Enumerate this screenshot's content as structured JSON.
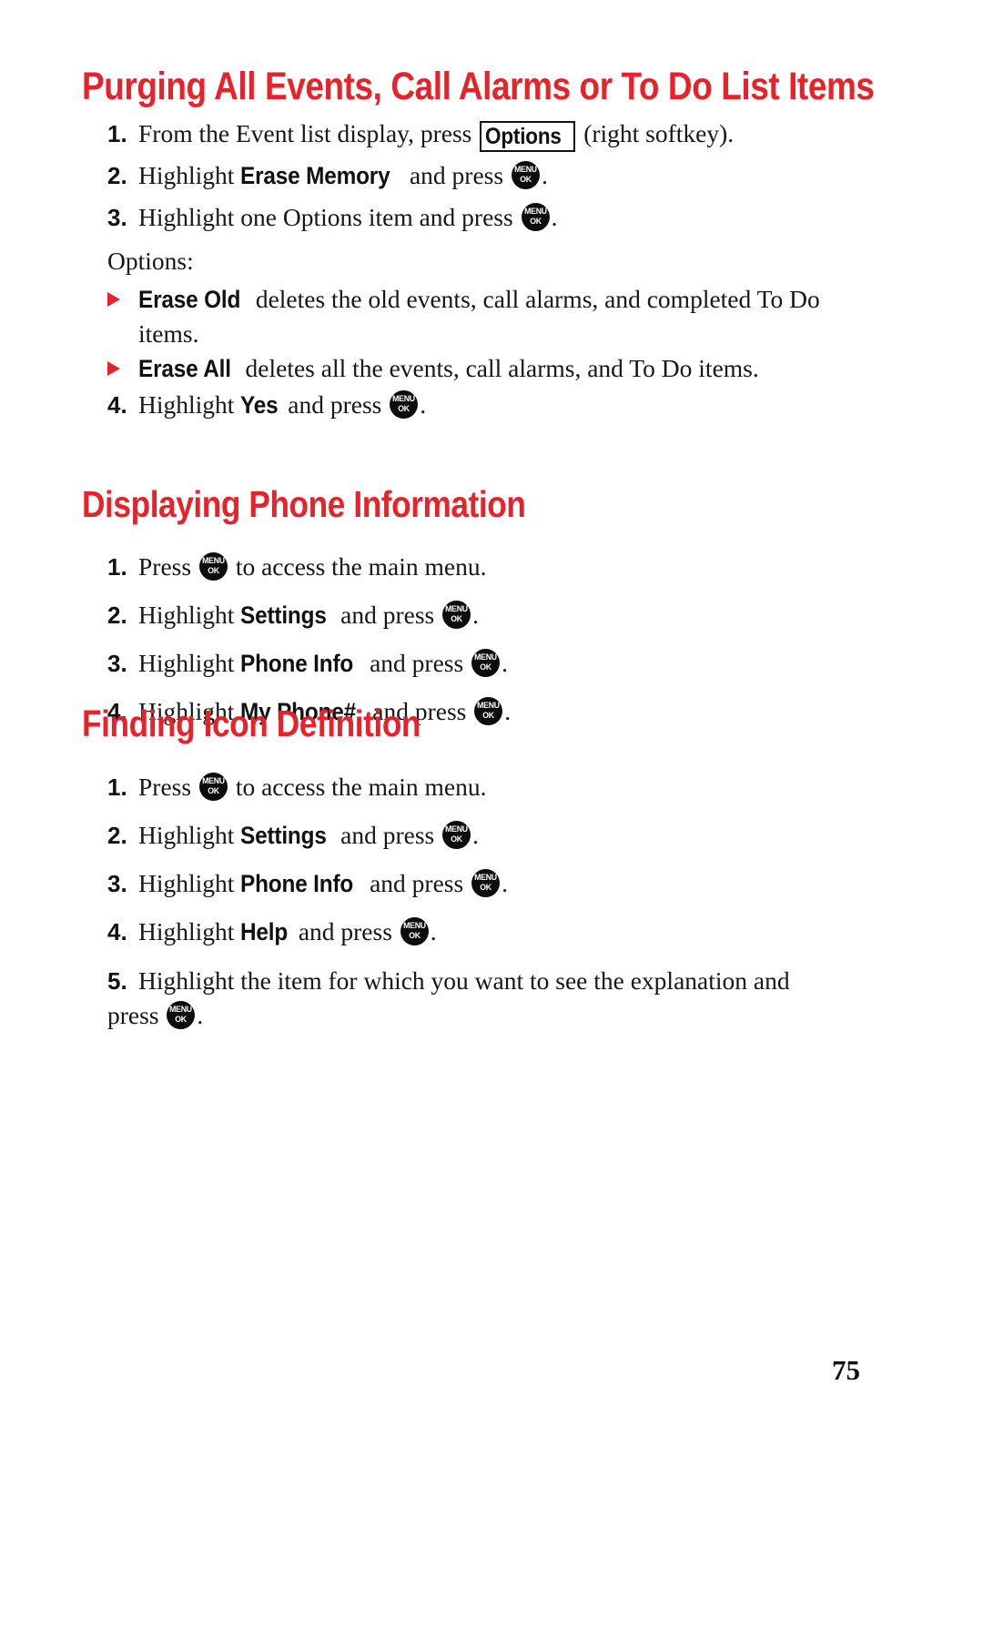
{
  "document": {
    "page_number": "75",
    "accent_color": "#e8222a",
    "text_color": "#171717",
    "key_icon": {
      "name": "menu-ok-key-icon",
      "line1": "MENU",
      "line2": "OK"
    }
  },
  "sections": [
    {
      "id": "purging",
      "heading": "Purging All Events, Call Alarms or To Do List Items",
      "steps": [
        {
          "number": "1.",
          "parts": [
            {
              "type": "text",
              "value": "From the Event list display, press "
            },
            {
              "type": "softkey",
              "value": "Options"
            },
            {
              "type": "text",
              "value": " (right softkey)."
            }
          ]
        },
        {
          "number": "2.",
          "parts": [
            {
              "type": "text",
              "value": "Highlight "
            },
            {
              "type": "ui",
              "value": "Erase Memory"
            },
            {
              "type": "text",
              "value": " and press "
            },
            {
              "type": "key",
              "value": "MENU/OK"
            },
            {
              "type": "text",
              "value": "."
            }
          ]
        },
        {
          "number": "3.",
          "parts": [
            {
              "type": "text",
              "value": "Highlight one Options item and press "
            },
            {
              "type": "key",
              "value": "MENU/OK"
            },
            {
              "type": "text",
              "value": "."
            }
          ]
        }
      ],
      "options_label": "Options:",
      "options": [
        {
          "term": "Erase Old",
          "description": " deletes the old events, call alarms, and completed To Do items."
        },
        {
          "term": "Erase All",
          "description": " deletes all the events, call alarms, and To Do items."
        }
      ],
      "final_step": {
        "number": "4.",
        "parts": [
          {
            "type": "text",
            "value": "Highlight "
          },
          {
            "type": "ui",
            "value": "Yes"
          },
          {
            "type": "text",
            "value": " and press "
          },
          {
            "type": "key",
            "value": "MENU/OK"
          },
          {
            "type": "text",
            "value": "."
          }
        ]
      }
    },
    {
      "id": "displaying-phone-information",
      "heading": "Displaying Phone Information",
      "steps": [
        {
          "number": "1.",
          "parts": [
            {
              "type": "text",
              "value": "Press "
            },
            {
              "type": "key",
              "value": "MENU/OK"
            },
            {
              "type": "text",
              "value": " to access the main menu."
            }
          ]
        },
        {
          "number": "2.",
          "parts": [
            {
              "type": "text",
              "value": "Highlight "
            },
            {
              "type": "ui",
              "value": "Settings"
            },
            {
              "type": "text",
              "value": " and press "
            },
            {
              "type": "key",
              "value": "MENU/OK"
            },
            {
              "type": "text",
              "value": "."
            }
          ]
        },
        {
          "number": "3.",
          "parts": [
            {
              "type": "text",
              "value": "Highlight "
            },
            {
              "type": "ui",
              "value": "Phone Info"
            },
            {
              "type": "text",
              "value": " and press "
            },
            {
              "type": "key",
              "value": "MENU/OK"
            },
            {
              "type": "text",
              "value": "."
            }
          ]
        },
        {
          "number": "4.",
          "parts": [
            {
              "type": "text",
              "value": "Highlight "
            },
            {
              "type": "ui",
              "value": "My Phone#"
            },
            {
              "type": "text",
              "value": " and press "
            },
            {
              "type": "key",
              "value": "MENU/OK"
            },
            {
              "type": "text",
              "value": "."
            }
          ]
        }
      ]
    },
    {
      "id": "finding-icon-definition",
      "heading": "Finding Icon Definition",
      "steps": [
        {
          "number": "1.",
          "parts": [
            {
              "type": "text",
              "value": "Press "
            },
            {
              "type": "key",
              "value": "MENU/OK"
            },
            {
              "type": "text",
              "value": " to access the main menu."
            }
          ]
        },
        {
          "number": "2.",
          "parts": [
            {
              "type": "text",
              "value": "Highlight "
            },
            {
              "type": "ui",
              "value": "Settings"
            },
            {
              "type": "text",
              "value": " and press "
            },
            {
              "type": "key",
              "value": "MENU/OK"
            },
            {
              "type": "text",
              "value": "."
            }
          ]
        },
        {
          "number": "3.",
          "parts": [
            {
              "type": "text",
              "value": "Highlight "
            },
            {
              "type": "ui",
              "value": "Phone Info"
            },
            {
              "type": "text",
              "value": " and press "
            },
            {
              "type": "key",
              "value": "MENU/OK"
            },
            {
              "type": "text",
              "value": "."
            }
          ]
        },
        {
          "number": "4.",
          "parts": [
            {
              "type": "text",
              "value": "Highlight "
            },
            {
              "type": "ui",
              "value": "Help"
            },
            {
              "type": "text",
              "value": " and press "
            },
            {
              "type": "key",
              "value": "MENU/OK"
            },
            {
              "type": "text",
              "value": "."
            }
          ]
        },
        {
          "number": "5.",
          "parts": [
            {
              "type": "text",
              "value": "Highlight the item for which you want to see the explanation and press "
            },
            {
              "type": "key",
              "value": "MENU/OK"
            },
            {
              "type": "text",
              "value": "."
            }
          ]
        }
      ]
    }
  ]
}
